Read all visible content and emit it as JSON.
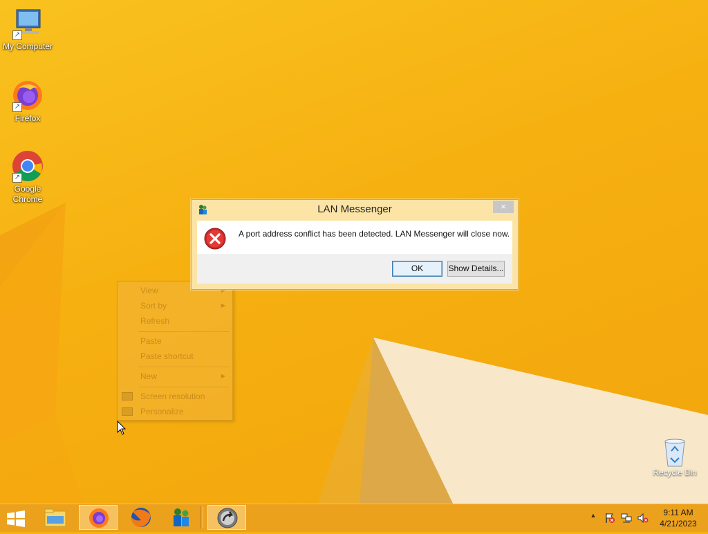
{
  "desktop": {
    "icons": [
      {
        "label": "My Computer",
        "icon": "computer-icon"
      },
      {
        "label": "Firefox",
        "icon": "firefox-icon"
      },
      {
        "label": "Google Chrome",
        "icon": "chrome-icon"
      },
      {
        "label": "Recycle Bin",
        "icon": "recycle-bin-icon"
      }
    ]
  },
  "context_menu": {
    "items": [
      {
        "label": "View",
        "has_submenu": true
      },
      {
        "label": "Sort by",
        "has_submenu": true
      },
      {
        "label": "Refresh"
      },
      {
        "label": "Paste"
      },
      {
        "label": "Paste shortcut"
      },
      {
        "label": "New",
        "has_submenu": true
      },
      {
        "label": "Screen resolution",
        "icon": "display-icon"
      },
      {
        "label": "Personalize",
        "icon": "personalize-icon"
      }
    ]
  },
  "dialog": {
    "title": "LAN Messenger",
    "message": "A port address conflict has been detected. LAN Messenger will close now.",
    "close_glyph": "×",
    "ok_label": "OK",
    "details_label": "Show Details..."
  },
  "taskbar": {
    "buttons": [
      {
        "icon": "file-explorer-icon"
      },
      {
        "icon": "firefox-icon",
        "active": true
      },
      {
        "icon": "firefox-legacy-icon"
      },
      {
        "icon": "lan-messenger-icon"
      },
      {
        "icon": "setup-icon"
      }
    ],
    "tray": {
      "show_hidden_glyph": "▲",
      "icons": [
        "action-center-flag-icon",
        "network-icon",
        "volume-muted-icon"
      ]
    },
    "clock": {
      "time": "9:11 AM",
      "date": "4/21/2023"
    }
  },
  "colors": {
    "wallpaper": "#f7b214",
    "taskbar": "#eba01e",
    "error_red": "#d32f2f",
    "ok_button_border": "#3c7fb1"
  }
}
